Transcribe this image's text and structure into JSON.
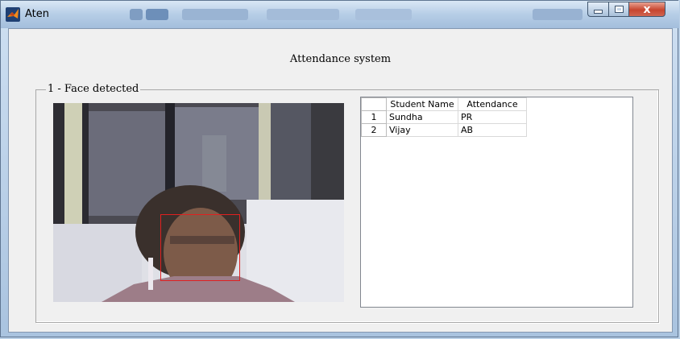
{
  "window": {
    "title": "Aten",
    "close_glyph": "x",
    "icons": [
      "matlab-icon",
      "minimize-icon",
      "maximize-icon",
      "close-icon"
    ]
  },
  "app": {
    "heading": "Attendance system"
  },
  "panel": {
    "title": "1 - Face detected"
  },
  "table": {
    "columns": [
      "Student Name",
      "Attendance"
    ],
    "rows": [
      {
        "index": "1",
        "name": "Sundha",
        "attendance": "PR"
      },
      {
        "index": "2",
        "name": "Vijay",
        "attendance": "AB"
      }
    ]
  },
  "colors": {
    "face_box": "#e02020",
    "window_close": "#c7452f"
  }
}
